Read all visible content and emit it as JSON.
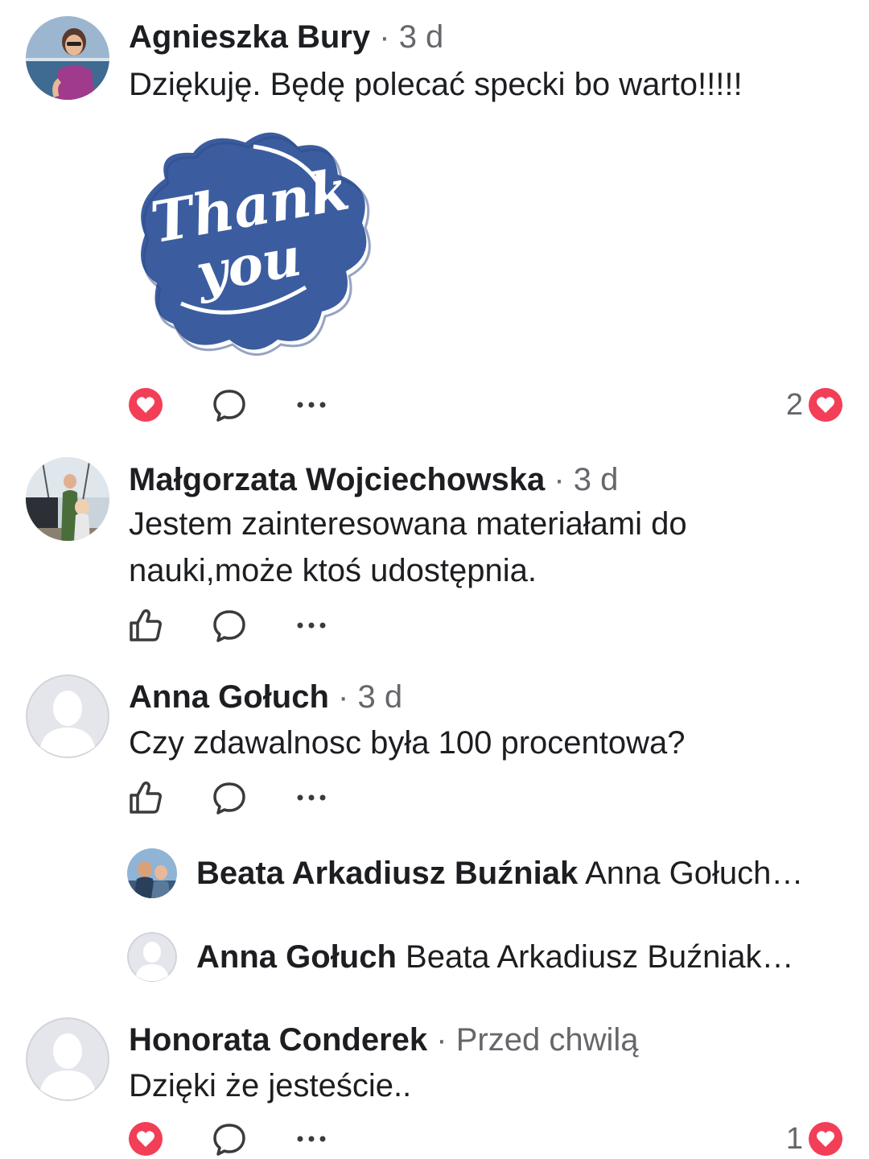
{
  "comments": [
    {
      "name": "Agnieszka Bury",
      "time": "3 d",
      "text": "Dziękuję. Będę polecać specki bo warto!!!!!",
      "sticker_text": "Thank you",
      "reaction": "love",
      "reaction_count": "2"
    },
    {
      "name": "Małgorzata Wojciechowska",
      "time": "3 d",
      "text": "Jestem zainteresowana materiałami do nauki,może ktoś udostępnia.",
      "reaction": "like"
    },
    {
      "name": "Anna Gołuch",
      "time": "3 d",
      "text": "Czy zdawalnosc była 100 procentowa?",
      "reaction": "like",
      "replies": [
        {
          "name": "Beata Arkadiusz Buźniak",
          "preview": "Anna Gołuch…"
        },
        {
          "name": "Anna Gołuch",
          "preview": "Beata Arkadiusz Buźniak…"
        }
      ]
    },
    {
      "name": "Honorata Conderek",
      "time": "Przed chwilą",
      "text": "Dzięki że jesteście..",
      "reaction": "love",
      "reaction_count": "1"
    }
  ],
  "separator": "·",
  "icons": {
    "love": "heart-reaction-icon",
    "like": "thumbs-up-icon",
    "reply": "speech-bubble-icon",
    "more": "more-dots-icon"
  },
  "colors": {
    "love_red": "#f33e58",
    "sticker_blue": "#3b5da0",
    "meta_gray": "#65676b",
    "text": "#1c1e21"
  }
}
